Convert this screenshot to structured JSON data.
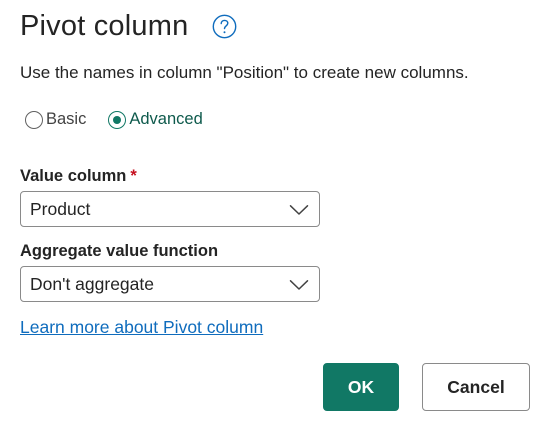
{
  "dialog": {
    "title": "Pivot column",
    "help_icon": "question-circle-icon",
    "description": "Use the names in column \"Position\" to create new columns."
  },
  "mode": {
    "options": [
      {
        "label": "Basic",
        "selected": false
      },
      {
        "label": "Advanced",
        "selected": true
      }
    ]
  },
  "value_column": {
    "label": "Value column",
    "required_mark": "*",
    "value": "Product",
    "icon": "chevron-down-icon"
  },
  "aggregate": {
    "label": "Aggregate value function",
    "value": "Don't aggregate",
    "icon": "chevron-down-icon"
  },
  "learn_more": {
    "label": "Learn more about Pivot column"
  },
  "buttons": {
    "ok_label": "OK",
    "cancel_label": "Cancel"
  },
  "colors": {
    "accent": "#117865",
    "link": "#0f6cbd",
    "required": "#c50f1f",
    "help_icon": "#0f6cbd"
  }
}
